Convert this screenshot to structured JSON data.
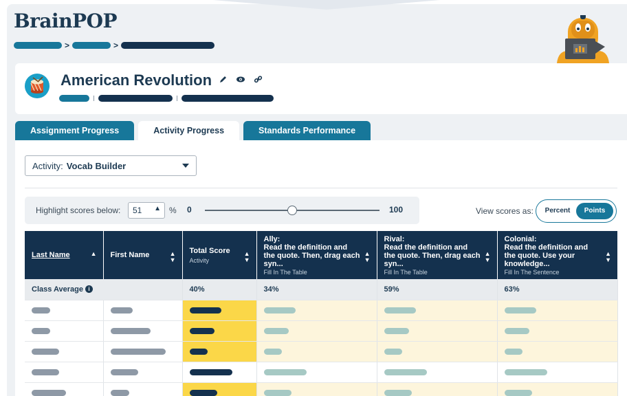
{
  "app": {
    "logo": "BrainPOP"
  },
  "header": {
    "title": "American Revolution",
    "icons": [
      "pencil-icon",
      "eye-icon",
      "link-icon"
    ]
  },
  "tabs": [
    {
      "label": "Assignment Progress",
      "active": false
    },
    {
      "label": "Activity Progress",
      "active": true
    },
    {
      "label": "Standards Performance",
      "active": false
    }
  ],
  "activity": {
    "label": "Activity:",
    "value": "Vocab Builder"
  },
  "highlight": {
    "label": "Highlight scores below:",
    "value": "51",
    "unit": "%",
    "min": "0",
    "max": "100",
    "slider_fraction": 0.5
  },
  "view_scores": {
    "label": "View scores as:",
    "options": [
      "Percent",
      "Points"
    ],
    "selected": "Points"
  },
  "table": {
    "columns": [
      {
        "title": "Last Name",
        "sub": ""
      },
      {
        "title": "First Name",
        "sub": ""
      },
      {
        "title": "Total Score",
        "sub": "Activity"
      },
      {
        "title": "Ally:",
        "desc": "Read the definition and the quote. Then, drag each syn...",
        "sub": "Fill In The Table"
      },
      {
        "title": "Rival:",
        "desc": "Read the definition and the quote. Then, drag each syn...",
        "sub": "Fill In The Table"
      },
      {
        "title": "Colonial:",
        "desc": "Read the definition and the quote. Use your knowledge...",
        "sub": "Fill In The Sentence"
      }
    ],
    "class_average": {
      "label": "Class Average",
      "values": [
        "40%",
        "34%",
        "59%",
        "63%"
      ]
    }
  },
  "colors": {
    "navy": "#14314e",
    "teal": "#17779a",
    "highlight_yellow": "#fbd748",
    "highlight_cream": "#fdf5dc"
  }
}
